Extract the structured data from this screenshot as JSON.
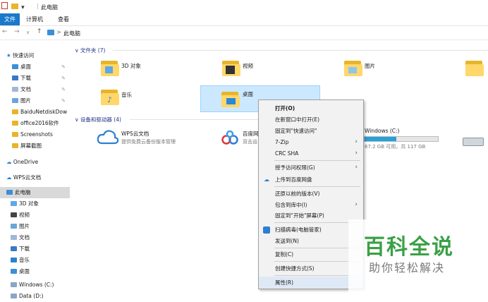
{
  "titlebar": {
    "title": "此电脑"
  },
  "ribbon": {
    "tabs": [
      "文件",
      "计算机",
      "查看"
    ]
  },
  "address": {
    "path": "此电脑",
    "sep": ">"
  },
  "sidebar": {
    "quick_access": "快速访问",
    "items": [
      {
        "label": "桌面",
        "pinned": true
      },
      {
        "label": "下载",
        "pinned": true
      },
      {
        "label": "文档",
        "pinned": true
      },
      {
        "label": "图片",
        "pinned": true
      },
      {
        "label": "BaiduNetdiskDow"
      },
      {
        "label": "office2016软件"
      },
      {
        "label": "Screenshots"
      },
      {
        "label": "屏幕截图"
      }
    ],
    "onedrive": "OneDrive",
    "wps": "WPS云文档",
    "this_pc": "此电脑",
    "pc_items": [
      "3D 对象",
      "视频",
      "图片",
      "文档",
      "下载",
      "音乐",
      "桌面",
      "Windows (C:)",
      "Data (D:)"
    ]
  },
  "main": {
    "folders_header": "文件夹 (7)",
    "folders": [
      "3D 对象",
      "视频",
      "图片",
      "音乐",
      "桌面"
    ],
    "devices_header": "设备和驱动器 (4)",
    "wps": {
      "name": "WPS云文档",
      "desc": "提供免费云备份版本管理"
    },
    "baidu": {
      "name": "百度网",
      "desc": "双击运"
    },
    "drive_c": {
      "name": "Windows (C:)",
      "free": "67.2 GB 可用，共 117 GB",
      "used_fraction": 0.43
    }
  },
  "context_menu": {
    "items": [
      "打开(O)",
      "在新窗口中打开(E)",
      "固定到\"快速访问\"",
      "7-Zip",
      "CRC SHA",
      "授予访问权限(G)",
      "上传到百度网盘",
      "还原以前的版本(V)",
      "包含到库中(I)",
      "固定到\"开始\"屏幕(P)",
      "扫描病毒(电脑管家)",
      "发送到(N)",
      "复制(C)",
      "创建快捷方式(S)",
      "属性(R)"
    ]
  },
  "watermark": {
    "title": "百科全说",
    "subtitle": "助你轻松解决"
  },
  "colors": {
    "accent": "#1979ca",
    "folder": "#ffd76a",
    "select": "#cce8ff",
    "watermark_green": "#3aa046"
  }
}
